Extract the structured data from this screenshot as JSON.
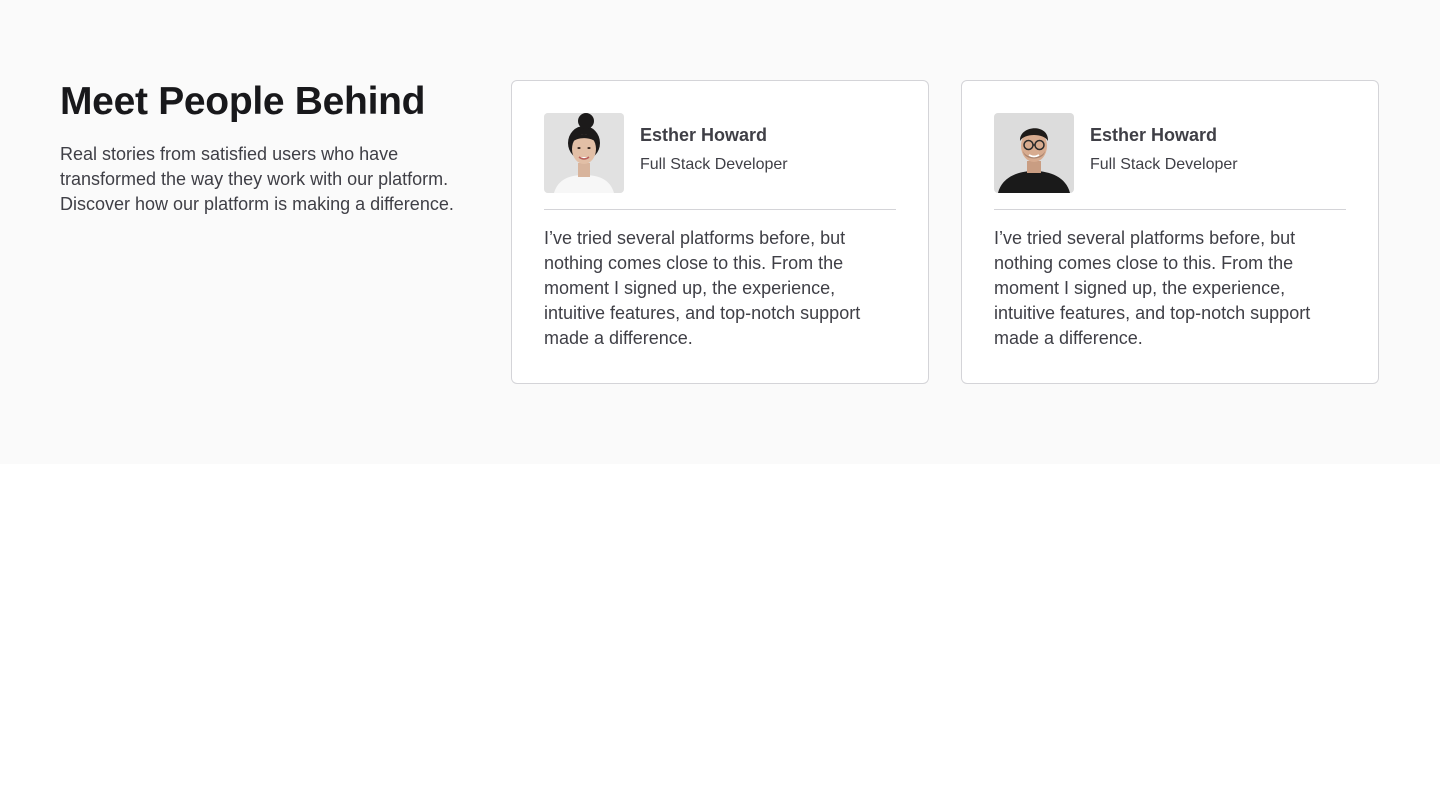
{
  "section": {
    "title": "Meet People Behind",
    "description": "Real stories from satisfied users who have transformed the way they work with our platform. Discover how our platform is making a difference."
  },
  "testimonials": [
    {
      "name": "Esther Howard",
      "role": "Full Stack Developer",
      "quote": "I’ve tried several platforms before, but nothing comes close to this. From the moment I signed up, the experience, intuitive features, and top-notch support made a difference.",
      "avatar": "woman-portrait-photo"
    },
    {
      "name": "Esther Howard",
      "role": "Full Stack Developer",
      "quote": "I’ve tried several platforms before, but nothing comes close to this. From the moment I signed up, the experience, intuitive features, and top-notch support made a difference.",
      "avatar": "man-portrait-photo"
    }
  ],
  "colors": {
    "section_background": "#fafafa",
    "card_background": "#ffffff",
    "card_border": "#d4d4d8",
    "heading": "#18181b",
    "body_text": "#3f3f46"
  }
}
